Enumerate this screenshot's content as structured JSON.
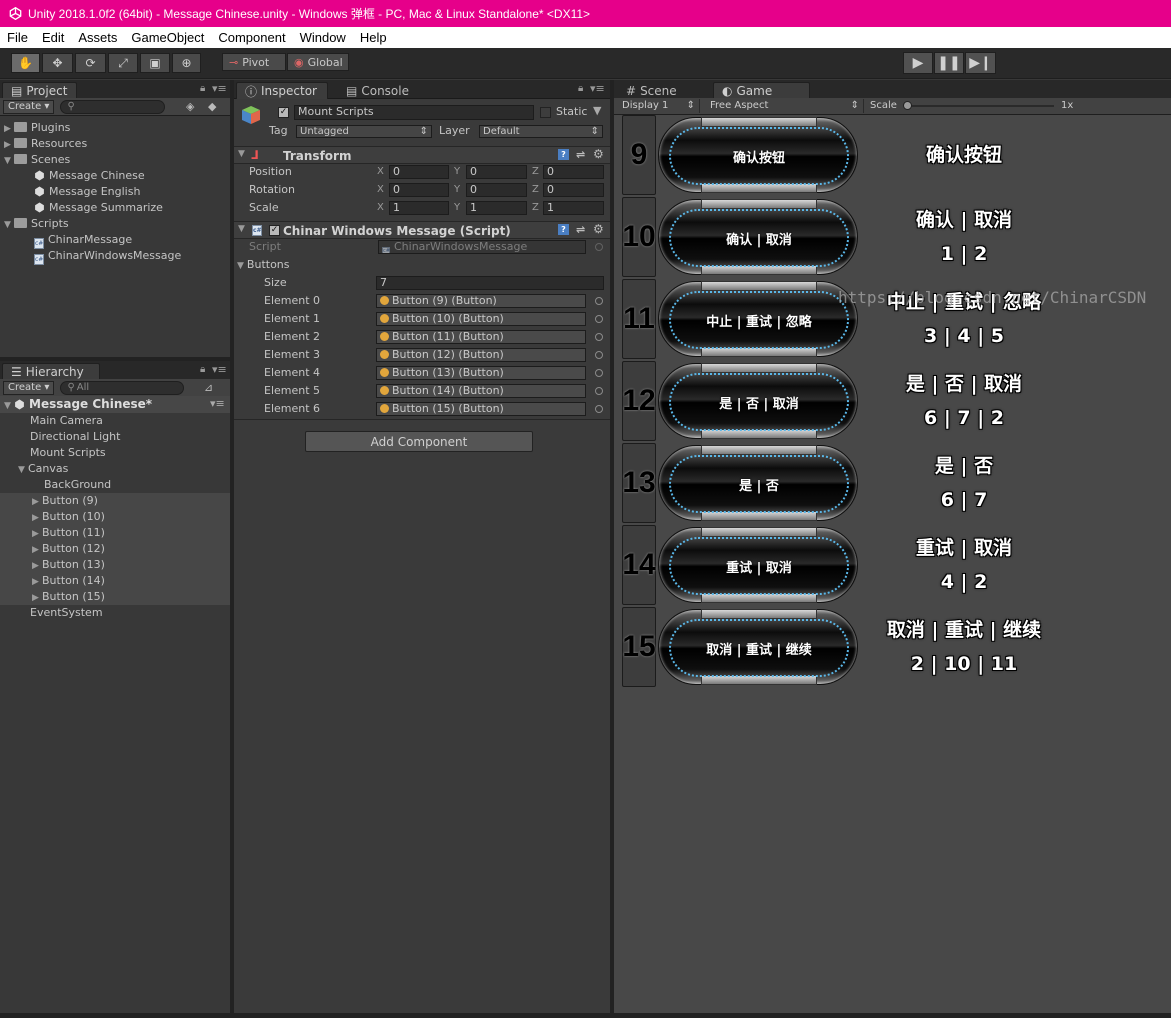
{
  "window": {
    "title": "Unity 2018.1.0f2 (64bit) - Message Chinese.unity - Windows 弹框 - PC, Mac & Linux Standalone* <DX11>"
  },
  "menu": [
    "File",
    "Edit",
    "Assets",
    "GameObject",
    "Component",
    "Window",
    "Help"
  ],
  "toolbar": {
    "pivot": "Pivot",
    "global": "Global"
  },
  "project": {
    "tab": "Project",
    "create": "Create ▾",
    "items": [
      "Plugins",
      "Resources",
      "Scenes",
      "Message Chinese",
      "Message English",
      "Message Summarize",
      "Scripts",
      "ChinarMessage",
      "ChinarWindowsMessage"
    ]
  },
  "hierarchy": {
    "tab": "Hierarchy",
    "create": "Create ▾",
    "search": "All",
    "scene": "Message Chinese*",
    "items": [
      "Main Camera",
      "Directional Light",
      "Mount Scripts",
      "Canvas",
      "BackGround",
      "Button (9)",
      "Button (10)",
      "Button (11)",
      "Button (12)",
      "Button (13)",
      "Button (14)",
      "Button (15)",
      "EventSystem"
    ]
  },
  "inspector": {
    "tab": "Inspector",
    "console_tab": "Console",
    "object_name": "Mount Scripts",
    "static_label": "Static",
    "tag_label": "Tag",
    "tag_value": "Untagged",
    "layer_label": "Layer",
    "layer_value": "Default",
    "transform": {
      "title": "Transform",
      "rows": [
        {
          "label": "Position",
          "x": "0",
          "y": "0",
          "z": "0"
        },
        {
          "label": "Rotation",
          "x": "0",
          "y": "0",
          "z": "0"
        },
        {
          "label": "Scale",
          "x": "1",
          "y": "1",
          "z": "1"
        }
      ],
      "axes": [
        "X",
        "Y",
        "Z"
      ]
    },
    "script": {
      "title": "Chinar Windows Message (Script)",
      "script_label": "Script",
      "script_value": "ChinarWindowsMessage",
      "buttons_label": "Buttons",
      "size_label": "Size",
      "size_value": "7",
      "elements": [
        {
          "label": "Element 0",
          "value": "Button (9) (Button)"
        },
        {
          "label": "Element 1",
          "value": "Button (10) (Button)"
        },
        {
          "label": "Element 2",
          "value": "Button (11) (Button)"
        },
        {
          "label": "Element 3",
          "value": "Button (12) (Button)"
        },
        {
          "label": "Element 4",
          "value": "Button (13) (Button)"
        },
        {
          "label": "Element 5",
          "value": "Button (14) (Button)"
        },
        {
          "label": "Element 6",
          "value": "Button (15) (Button)"
        }
      ]
    },
    "add_component": "Add Component"
  },
  "game": {
    "scene_tab": "Scene",
    "game_tab": "Game",
    "display": "Display 1",
    "aspect": "Free Aspect",
    "scale_label": "Scale",
    "scale_value": "1x",
    "rows": [
      {
        "num": "9",
        "button": "确认按钮",
        "line1": "确认按钮",
        "line2": ""
      },
      {
        "num": "10",
        "button": "确认 | 取消",
        "line1": "确认 | 取消",
        "line2": "1 | 2"
      },
      {
        "num": "11",
        "button": "中止 | 重试 | 忽略",
        "line1": "中止 | 重试 | 忽略",
        "line2": "3 | 4 | 5"
      },
      {
        "num": "12",
        "button": "是 | 否 | 取消",
        "line1": "是 | 否 | 取消",
        "line2": "6 | 7 | 2"
      },
      {
        "num": "13",
        "button": "是 | 否",
        "line1": "是 | 否",
        "line2": "6 | 7"
      },
      {
        "num": "14",
        "button": "重试 | 取消",
        "line1": "重试 | 取消",
        "line2": "4 | 2"
      },
      {
        "num": "15",
        "button": "取消 | 重试 | 继续",
        "line1": "取消 | 重试 | 继续",
        "line2": "2 | 10 | 11"
      }
    ],
    "watermark": "https://blog.csdn.net/ChinarCSDN"
  }
}
